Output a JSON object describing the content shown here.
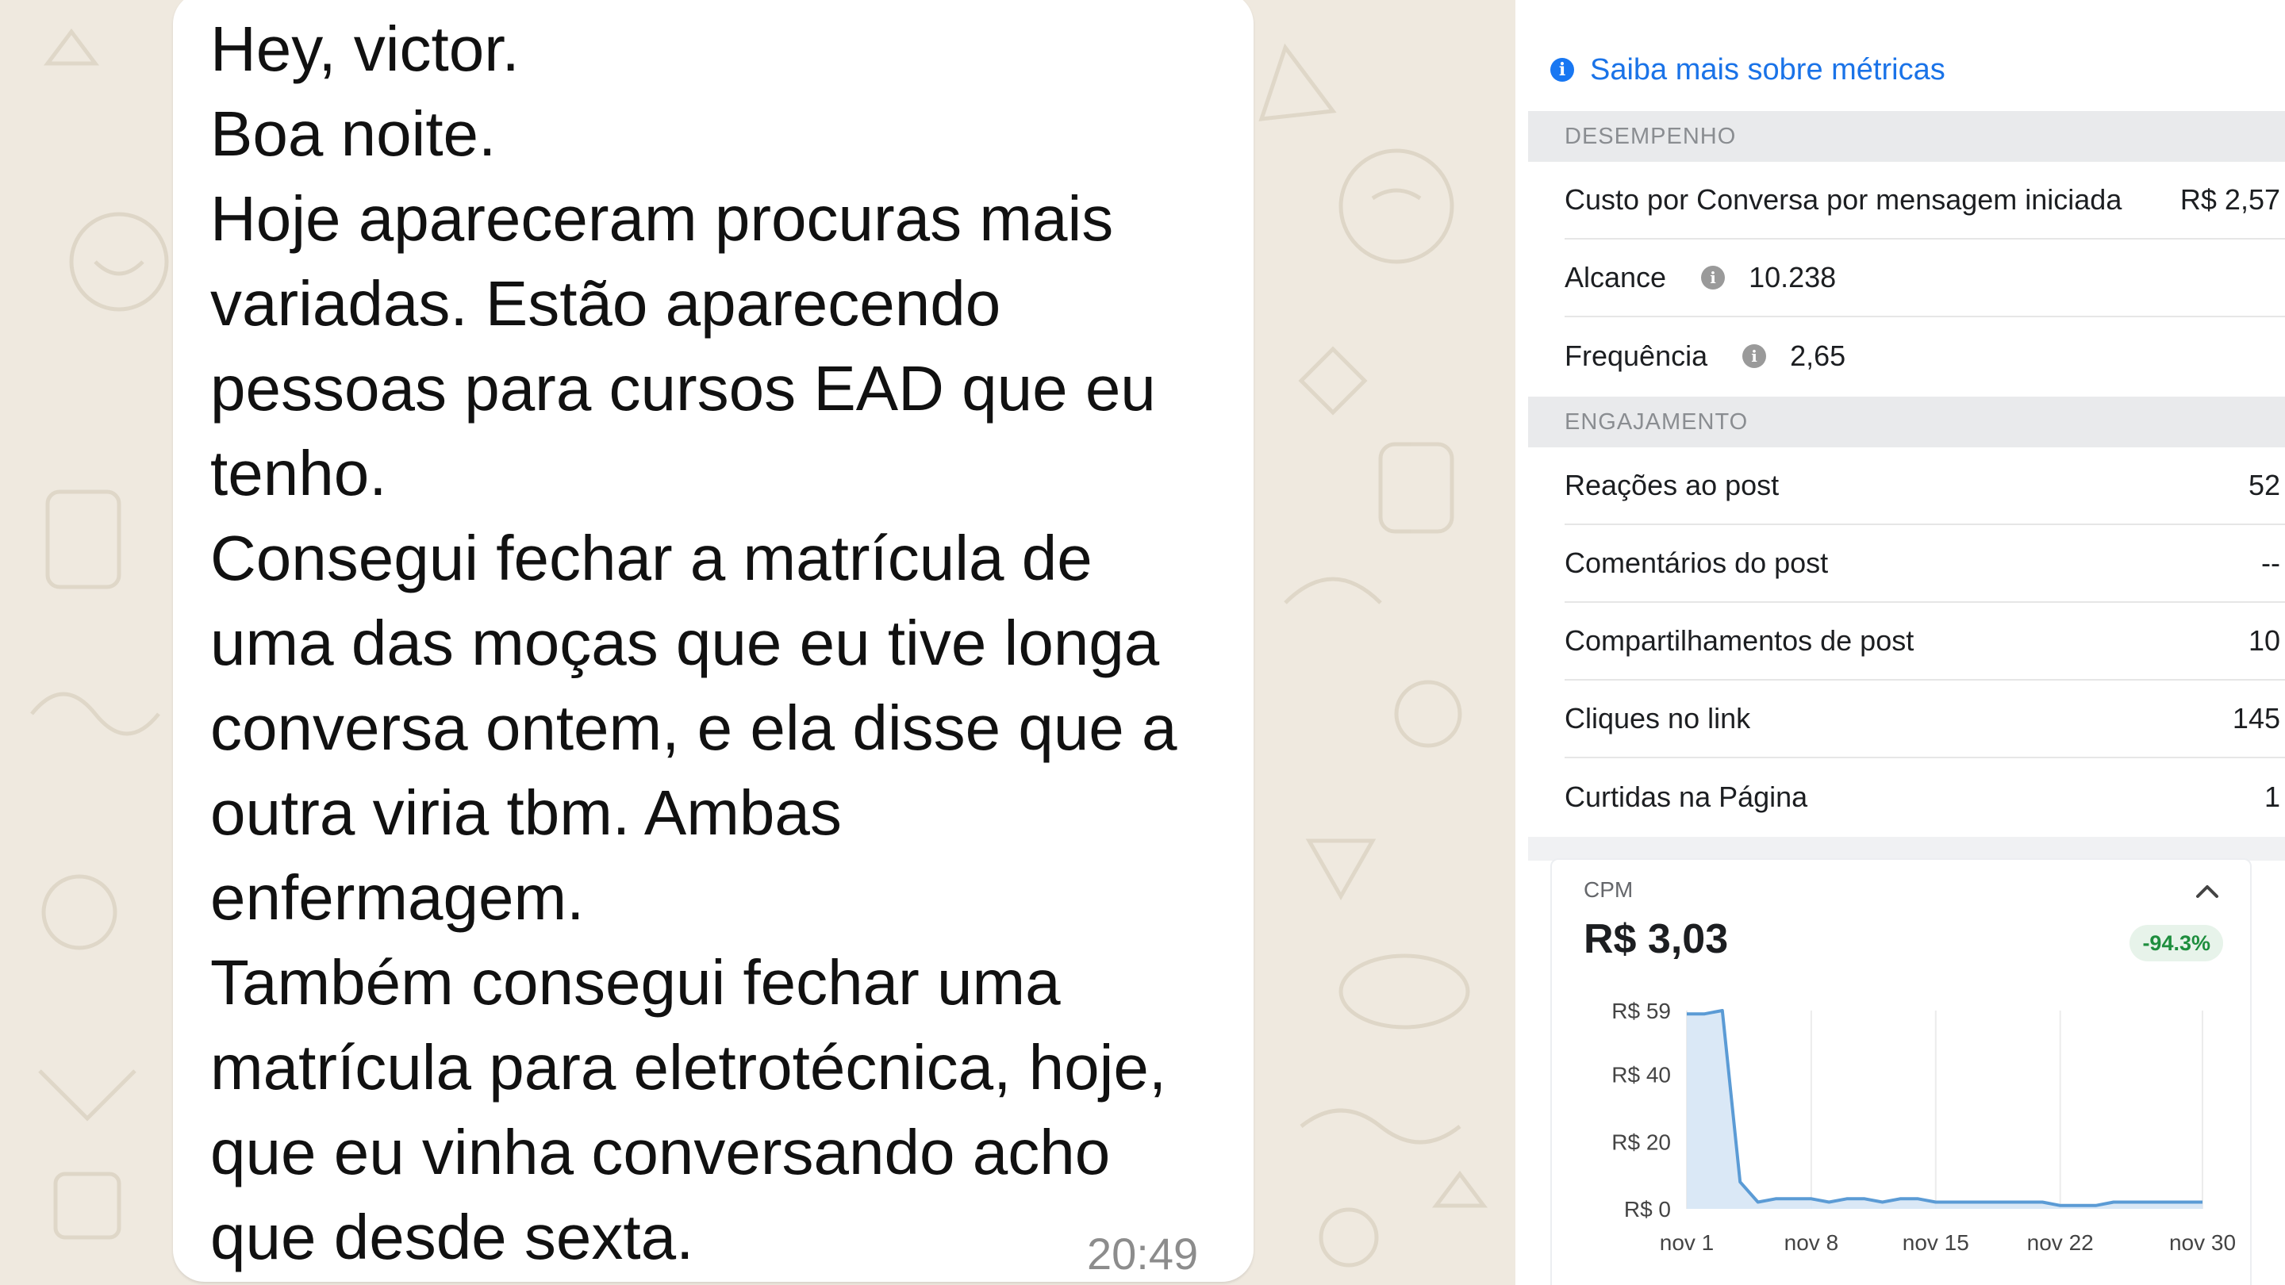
{
  "chat": {
    "lines": [
      "Hey, victor.",
      "Boa noite.",
      "Hoje apareceram procuras mais",
      "variadas. Estão aparecendo",
      "pessoas para cursos EAD que eu",
      "tenho.",
      "Consegui fechar a matrícula de",
      "uma das moças que eu tive longa",
      "conversa ontem, e ela disse que a",
      "outra viria tbm. Ambas",
      "enfermagem.",
      "Também consegui fechar uma",
      "matrícula para eletrotécnica, hoje,",
      "que eu vinha conversando acho",
      "que desde sexta."
    ],
    "time": "20:49",
    "colors": {
      "wallpaper": "#efe9df",
      "bubble": "#ffffff",
      "text": "#111111"
    }
  },
  "metrics": {
    "learn_more": "Saiba mais sobre métricas",
    "learn_more_icon": "info-icon",
    "sections": {
      "performance": {
        "header": "DESEMPENHO",
        "rows": [
          {
            "label": "Custo por Conversa por mensagem iniciada",
            "value": "R$ 2,57"
          },
          {
            "label": "Alcance",
            "value": "10.238",
            "info_icon": true
          },
          {
            "label": "Frequência",
            "value": "2,65",
            "info_icon": true
          }
        ]
      },
      "engagement": {
        "header": "ENGAJAMENTO",
        "rows": [
          {
            "label": "Reações ao post",
            "value": "52"
          },
          {
            "label": "Comentários do post",
            "value": "--"
          },
          {
            "label": "Compartilhamentos de post",
            "value": "10"
          },
          {
            "label": "Cliques no link",
            "value": "145"
          },
          {
            "label": "Curtidas na Página",
            "value": "1"
          }
        ]
      }
    },
    "cpm_card": {
      "label": "CPM",
      "value": "R$ 3,03",
      "change": "-94.3%",
      "toggle_icon": "chevron-up-icon"
    },
    "colors": {
      "link": "#1a73e8",
      "positive_badge_bg": "#e7f3ea",
      "positive_badge_text": "#1e8e3e",
      "line": "#5b9bd5",
      "fill": "#d6e6f5"
    }
  },
  "chart_data": {
    "type": "area",
    "title": "CPM",
    "y_tick_labels": [
      "R$ 0",
      "R$ 20",
      "R$ 40",
      "R$ 59"
    ],
    "y_ticks": [
      0,
      20,
      40,
      59
    ],
    "ylim": [
      0,
      59
    ],
    "x_tick_labels": [
      "nov 1",
      "nov 8",
      "nov 15",
      "nov 22",
      "nov 30"
    ],
    "x_ticks": [
      1,
      8,
      15,
      22,
      30
    ],
    "xlim": [
      1,
      30
    ],
    "series": [
      {
        "x": [
          1,
          2,
          3,
          4,
          5,
          6,
          7,
          8,
          9,
          10,
          11,
          12,
          13,
          14,
          15,
          16,
          17,
          18,
          19,
          20,
          21,
          22,
          23,
          24,
          25,
          26,
          27,
          28,
          29,
          30
        ],
        "values": [
          58,
          58,
          59,
          8,
          2,
          3,
          3,
          3,
          2,
          3,
          3,
          2,
          3,
          3,
          2,
          2,
          2,
          2,
          2,
          2,
          2,
          1,
          1,
          1,
          2,
          2,
          2,
          2,
          2,
          2
        ]
      }
    ],
    "grid": "vertical"
  }
}
